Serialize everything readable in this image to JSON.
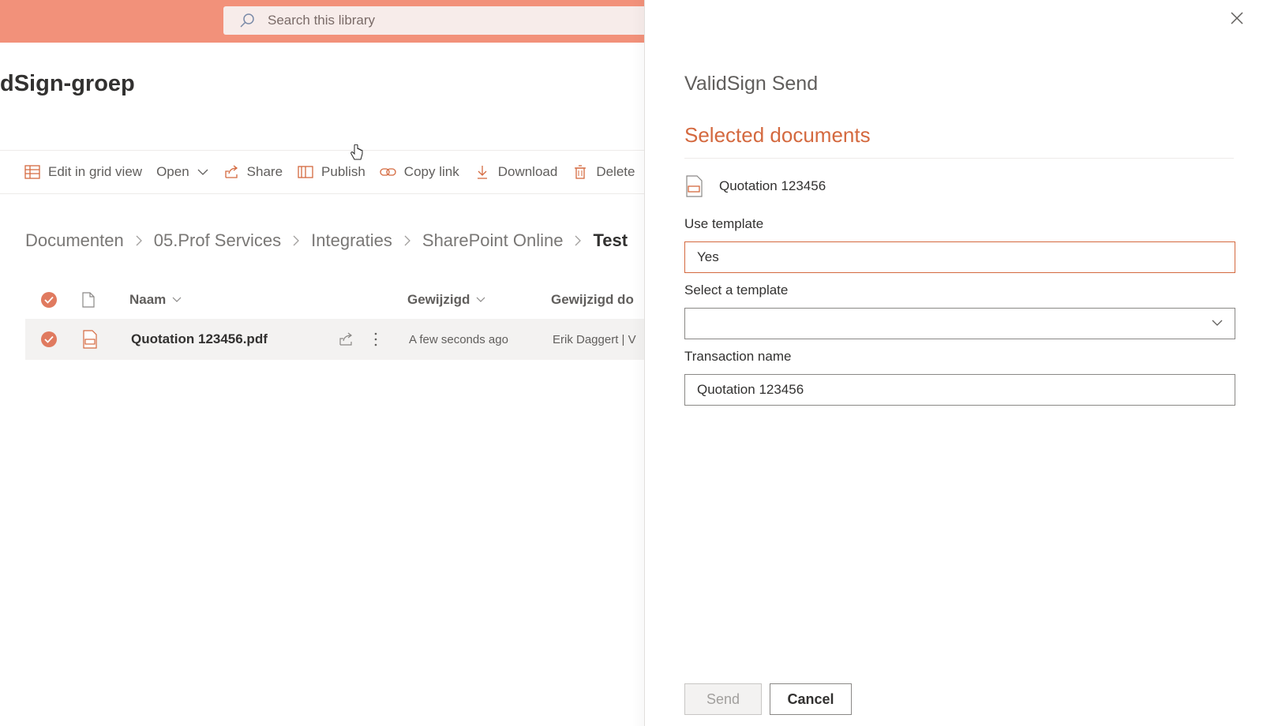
{
  "search": {
    "placeholder": "Search this library"
  },
  "site": {
    "title": "dSign-groep"
  },
  "commandbar": {
    "items": [
      {
        "label": "Edit in grid view"
      },
      {
        "label": "Open"
      },
      {
        "label": "Share"
      },
      {
        "label": "Publish"
      },
      {
        "label": "Copy link"
      },
      {
        "label": "Download"
      },
      {
        "label": "Delete"
      }
    ]
  },
  "breadcrumb": [
    "Documenten",
    "05.Prof Services",
    "Integraties",
    "SharePoint Online",
    "Test"
  ],
  "table": {
    "columns": [
      "Naam",
      "Gewijzigd",
      "Gewijzigd do"
    ],
    "rows": [
      {
        "name": "Quotation 123456.pdf",
        "modified": "A few seconds ago",
        "modified_by": "Erik Daggert | V"
      }
    ]
  },
  "panel": {
    "title": "ValidSign Send",
    "section_title": "Selected documents",
    "document_name": "Quotation 123456",
    "use_template_label": "Use template",
    "use_template_value": "Yes",
    "select_template_label": "Select a template",
    "select_template_value": "",
    "transaction_label": "Transaction name",
    "transaction_value": "Quotation 123456",
    "send_label": "Send",
    "cancel_label": "Cancel"
  },
  "colors": {
    "accent": "#d4693f",
    "topbar": "#f2917a",
    "check": "#e07a5f"
  }
}
